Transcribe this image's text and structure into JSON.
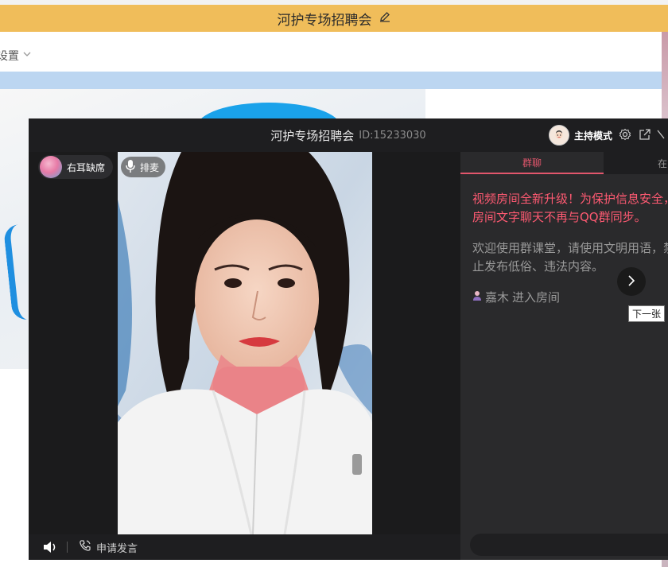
{
  "background": {
    "title": "河护专场招聘会",
    "settings_label": "设置"
  },
  "modal": {
    "title": "河护专场招聘会",
    "room_id": "ID:15233030",
    "host_mode_label": "主持模式",
    "user_name": "右耳缺席",
    "queue_label": "排麦",
    "apply_speak_label": "申请发言"
  },
  "chat": {
    "tab_group": "群聊",
    "tab_other": "在",
    "system_message": "视频房间全新升级！为保护信息安全，房间文字聊天不再与QQ群同步。",
    "welcome_message": "欢迎使用群课堂，请使用文明用语，禁止发布低俗、违法内容。",
    "enter_user": "嘉木",
    "enter_action": "进入房间"
  },
  "tooltip": {
    "next_label": "下一张"
  },
  "colors": {
    "title_bar": "#f0bd5a",
    "blue_bar": "#bcd6f1",
    "accent_pink": "#e2566c",
    "system_text": "#ff5a72",
    "modal_bg": "#232325"
  },
  "icons": [
    "edit-icon",
    "chevron-down-icon",
    "settings-icon",
    "popout-icon",
    "mic-icon",
    "volume-icon",
    "phone-icon",
    "chevron-right-icon",
    "user-icon"
  ]
}
